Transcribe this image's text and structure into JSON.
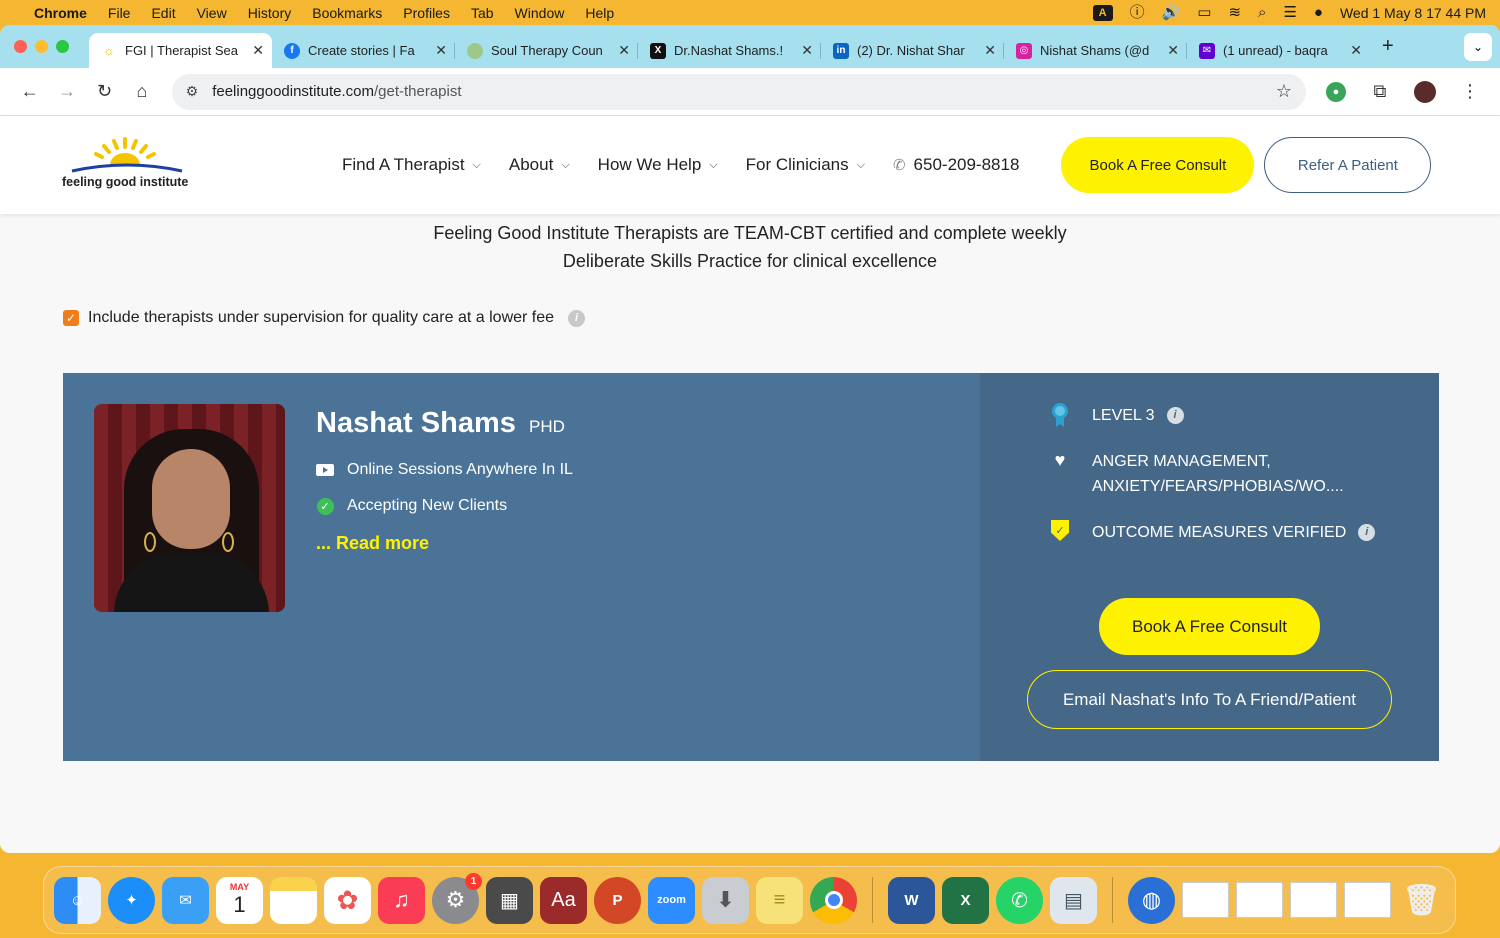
{
  "menubar": {
    "app": "Chrome",
    "menus": [
      "File",
      "Edit",
      "View",
      "History",
      "Bookmarks",
      "Profiles",
      "Tab",
      "Window",
      "Help"
    ],
    "input_badge": "A",
    "datetime": "Wed 1 May  8 17 44 PM"
  },
  "tabs": [
    {
      "label": "FGI | Therapist Sea",
      "icon": "sun-logo-icon",
      "color": "#f5c400"
    },
    {
      "label": "Create stories | Fa",
      "icon": "facebook-icon",
      "color": "#1877f2"
    },
    {
      "label": "Soul Therapy Coun",
      "icon": "soul-therapy-icon",
      "color": "#9cc98a"
    },
    {
      "label": "Dr.Nashat Shams.!",
      "icon": "x-icon",
      "color": "#111111"
    },
    {
      "label": "(2) Dr. Nishat Shar",
      "icon": "linkedin-icon",
      "color": "#0a66c2"
    },
    {
      "label": "Nishat Shams (@d",
      "icon": "instagram-icon",
      "color": "#d6249f"
    },
    {
      "label": "(1 unread) - baqra",
      "icon": "yahoo-mail-icon",
      "color": "#6001d2"
    }
  ],
  "address": {
    "host": "feelinggoodinstitute.com",
    "path": "/get-therapist"
  },
  "site": {
    "logo_text": "feeling good institute",
    "nav": [
      "Find A Therapist",
      "About",
      "How We Help",
      "For Clinicians"
    ],
    "phone": "650-209-8818",
    "book_label": "Book A Free Consult",
    "refer_label": "Refer A Patient"
  },
  "intro": {
    "line1": "Feeling Good Institute Therapists are TEAM-CBT certified and complete weekly",
    "line2": "Deliberate Skills Practice for clinical excellence"
  },
  "supervision": {
    "label": "Include therapists under supervision for quality care at a lower fee",
    "checked": true
  },
  "therapist": {
    "name": "Nashat Shams",
    "credential": "PHD",
    "session": "Online Sessions Anywhere In IL",
    "accepting": "Accepting New Clients",
    "read_more": "... Read more",
    "level": "LEVEL 3",
    "specialties_line1": "ANGER MANAGEMENT,",
    "specialties_line2": "ANXIETY/FEARS/PHOBIAS/WO....",
    "outcome": "OUTCOME MEASURES VERIFIED",
    "book_label": "Book A Free Consult",
    "email_label": "Email Nashat's Info To A Friend/Patient"
  },
  "dock": {
    "calendar_month": "MAY",
    "calendar_day": "1",
    "settings_badge": "1",
    "dictionary_label": "Aa",
    "zoom_label": "zoom"
  },
  "colors": {
    "accent_yellow": "#fff200",
    "card_blue": "#4b7398",
    "card_blue_dark": "#456889",
    "menubar": "#f5b731",
    "tabbar": "#a6e0ef"
  }
}
